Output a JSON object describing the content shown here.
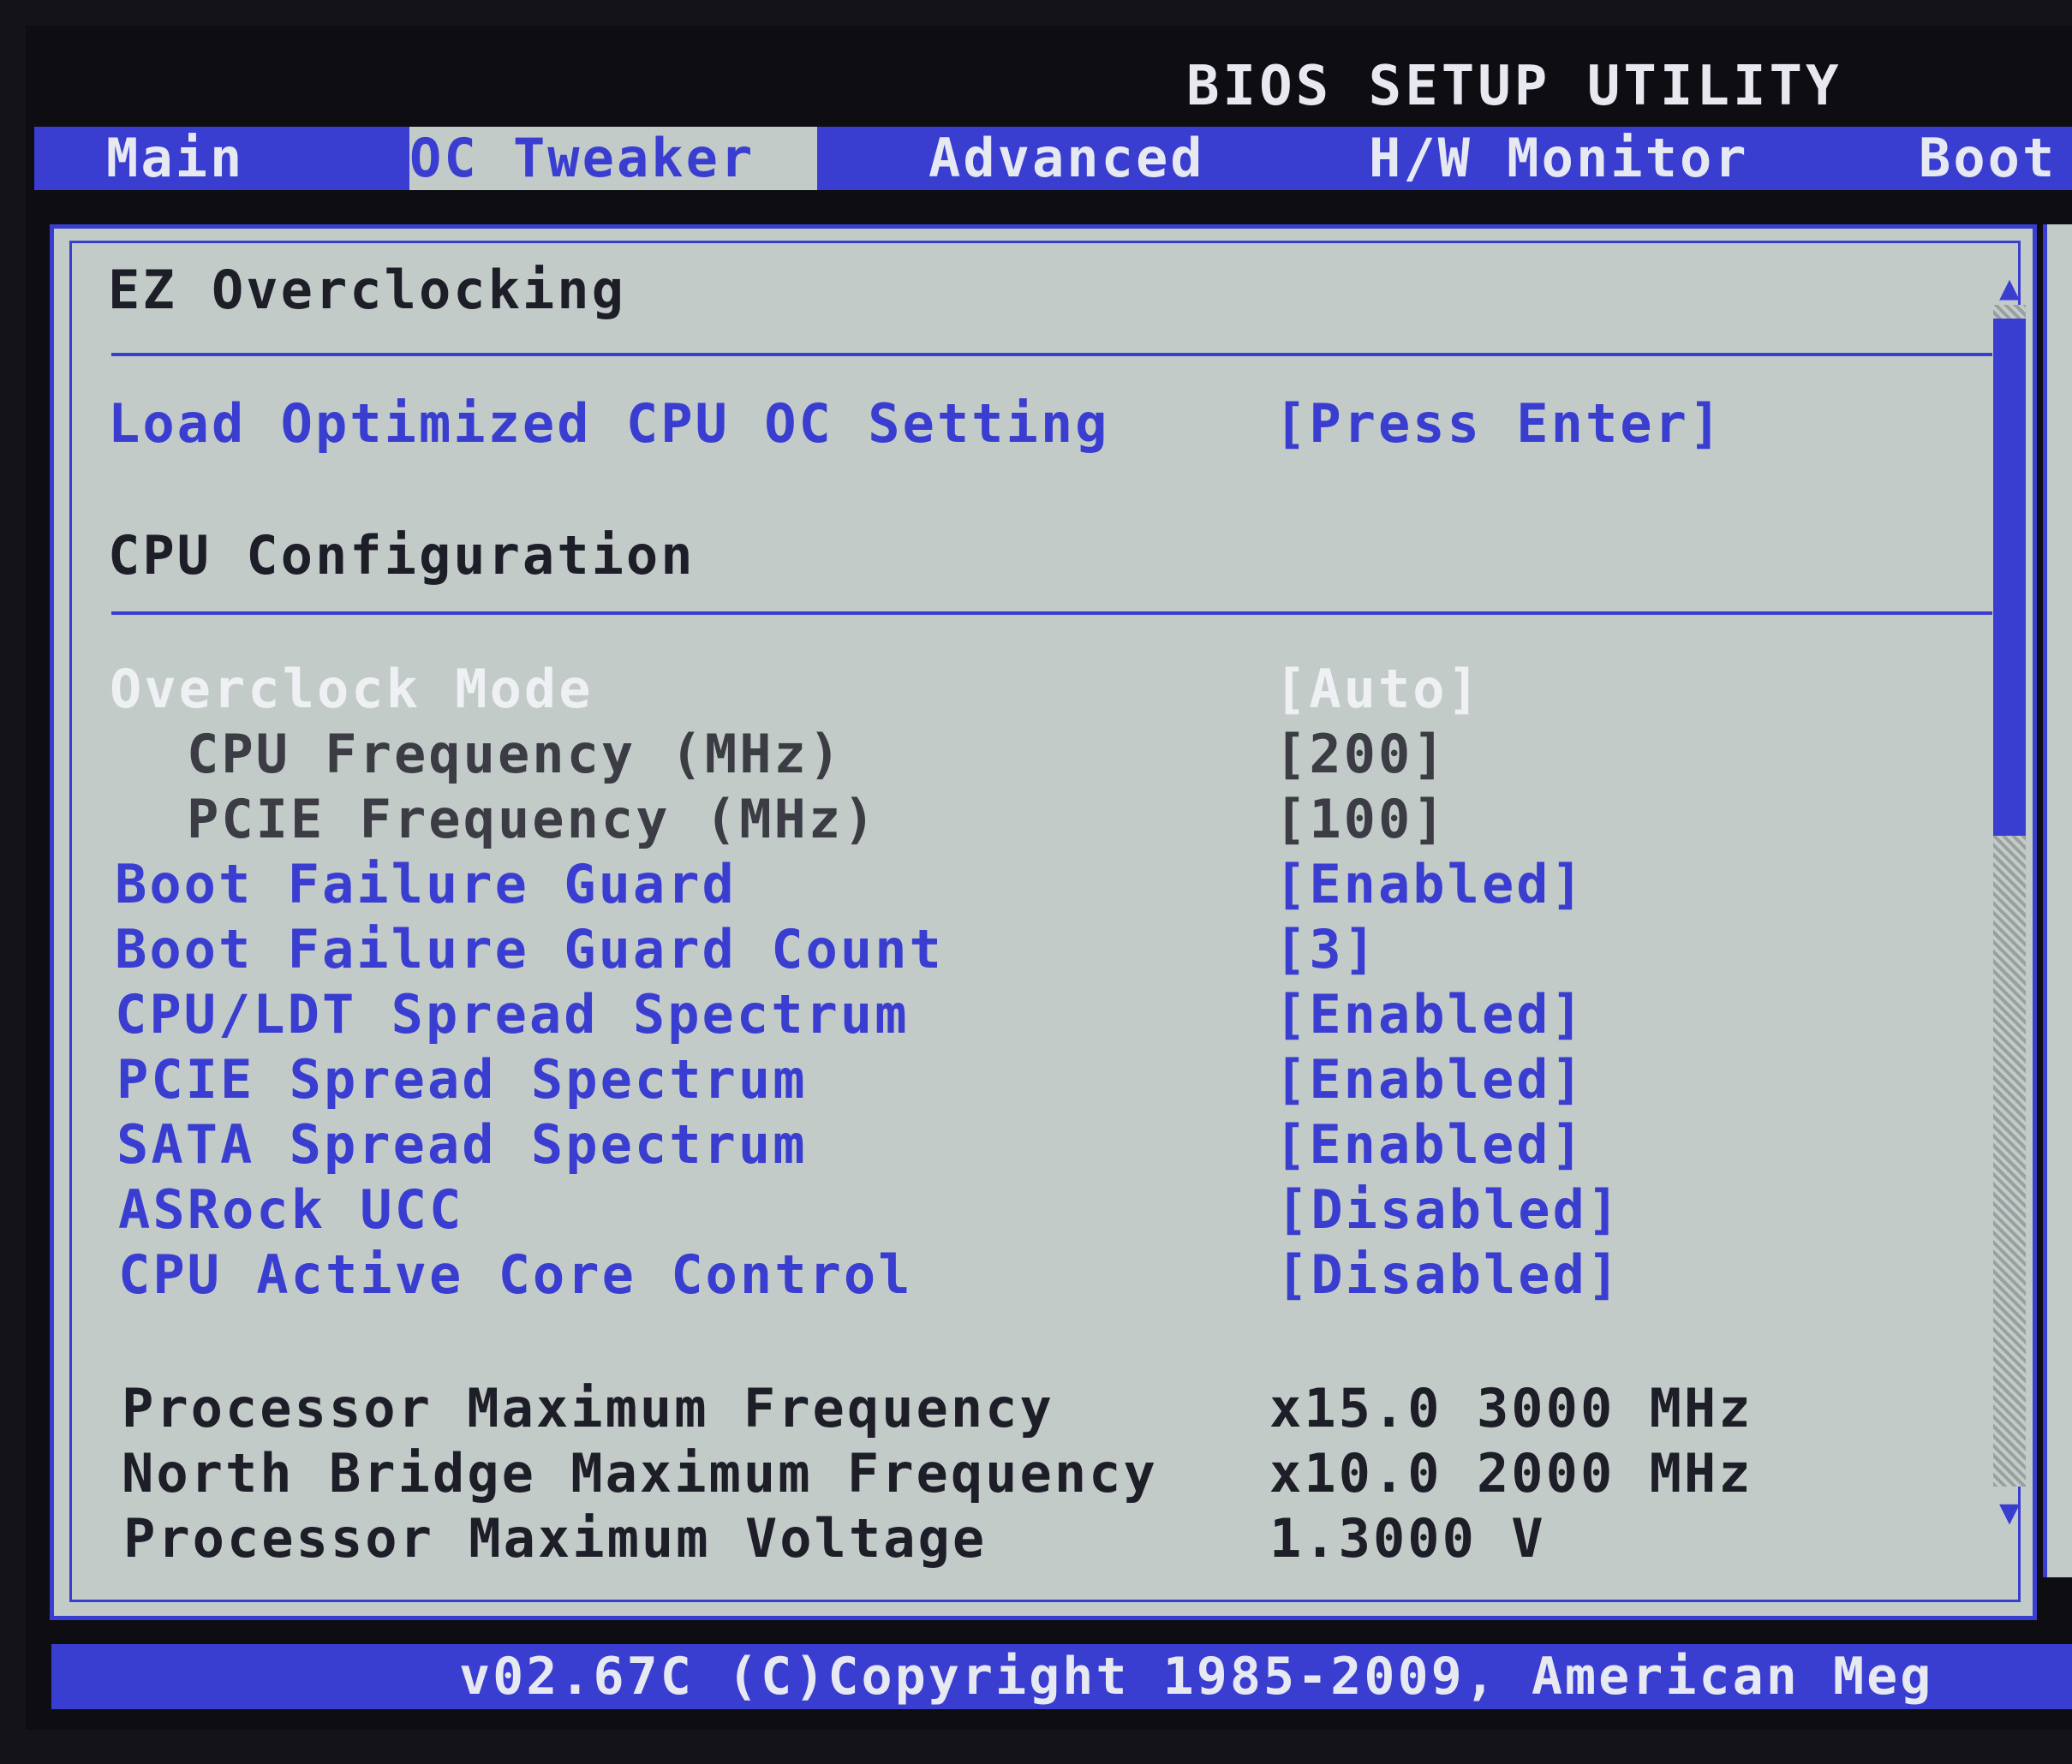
{
  "window": {
    "title": "BIOS SETUP UTILITY"
  },
  "tabs": [
    {
      "label": "Main"
    },
    {
      "label": "OC Tweaker"
    },
    {
      "label": "Advanced"
    },
    {
      "label": "H/W Monitor"
    },
    {
      "label": "Boot"
    }
  ],
  "active_tab": "OC Tweaker",
  "sections": {
    "ez": "EZ Overclocking",
    "cpu": "CPU Configuration"
  },
  "items": [
    {
      "label": "Load Optimized CPU OC Setting",
      "value": "[Press Enter]"
    },
    {
      "label": "Overclock Mode",
      "value": "[Auto]"
    },
    {
      "label": "CPU Frequency (MHz)",
      "value": "[200]"
    },
    {
      "label": "PCIE Frequency (MHz)",
      "value": "[100]"
    },
    {
      "label": "Boot Failure Guard",
      "value": "[Enabled]"
    },
    {
      "label": "Boot Failure Guard Count",
      "value": "[3]"
    },
    {
      "label": "CPU/LDT Spread Spectrum",
      "value": "[Enabled]"
    },
    {
      "label": "PCIE Spread Spectrum",
      "value": "[Enabled]"
    },
    {
      "label": "SATA Spread Spectrum",
      "value": "[Enabled]"
    },
    {
      "label": "ASRock UCC",
      "value": "[Disabled]"
    },
    {
      "label": "CPU Active Core Control",
      "value": "[Disabled]"
    }
  ],
  "info": [
    {
      "label": "Processor Maximum Frequency",
      "value": "x15.0 3000 MHz"
    },
    {
      "label": "North Bridge Maximum Frequency",
      "value": "x10.0 2000 MHz"
    },
    {
      "label": "Processor Maximum Voltage",
      "value": "1.3000 V"
    }
  ],
  "scrollbar": {
    "up_icon": "▲",
    "down_icon": "▼"
  },
  "footer": {
    "text": "v02.67C (C)Copyright 1985-2009, American Meg"
  },
  "colors": {
    "accent": "#3a3ed0",
    "panel": "#c3cbc8",
    "selected": "#eef0f4"
  }
}
